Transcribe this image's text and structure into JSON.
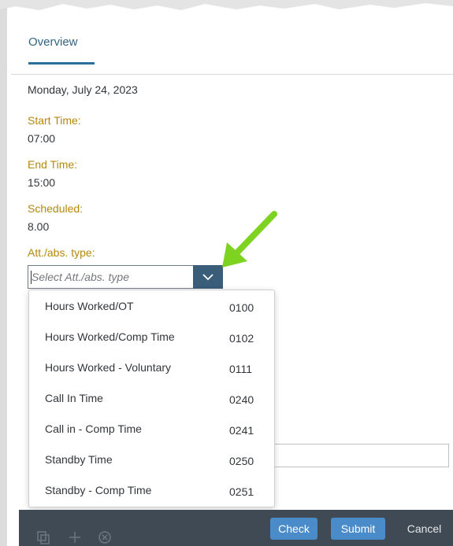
{
  "tabs": {
    "overview_label": "Overview"
  },
  "details": {
    "date": "Monday, July 24, 2023",
    "start_time_label": "Start Time:",
    "start_time_value": "07:00",
    "end_time_label": "End Time:",
    "end_time_value": "15:00",
    "scheduled_label": "Scheduled:",
    "scheduled_value": "8.00",
    "att_abs_type_label": "Att./abs. type:"
  },
  "att_abs_select": {
    "placeholder": "Select Att./abs. type"
  },
  "dropdown_options": [
    {
      "label": "Hours Worked/OT",
      "code": "0100"
    },
    {
      "label": "Hours Worked/Comp Time",
      "code": "0102"
    },
    {
      "label": "Hours Worked - Voluntary",
      "code": "0111"
    },
    {
      "label": "Call In Time",
      "code": "0240"
    },
    {
      "label": "Call in - Comp Time",
      "code": "0241"
    },
    {
      "label": "Standby Time",
      "code": "0250"
    },
    {
      "label": "Standby - Comp Time",
      "code": "0251"
    }
  ],
  "footer": {
    "check_label": "Check",
    "submit_label": "Submit",
    "cancel_label": "Cancel",
    "icons": [
      "copy-icon",
      "add-icon",
      "delete-icon"
    ]
  },
  "colors": {
    "label_gold": "#b5880d",
    "accent_blue": "#4a8bc9",
    "footer_bg": "#3f4a54",
    "arrow_green": "#7ed321"
  }
}
